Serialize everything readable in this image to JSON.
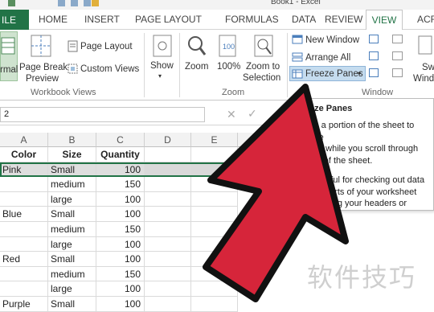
{
  "window": {
    "title": "Book1 - Excel"
  },
  "tabs": {
    "file": "ILE",
    "items": [
      "HOME",
      "INSERT",
      "PAGE LAYOUT",
      "FORMULAS",
      "DATA",
      "REVIEW"
    ],
    "active": "VIEW",
    "clipped": "ACR"
  },
  "ribbon": {
    "normal": "rmal",
    "page_break_preview_1": "Page Break",
    "page_break_preview_2": "Preview",
    "page_layout": "Page Layout",
    "custom_views": "Custom Views",
    "workbook_views_group": "Workbook Views",
    "show": "Show",
    "zoom": "Zoom",
    "zoom_100": "100%",
    "zoom_to_selection_1": "Zoom to",
    "zoom_to_selection_2": "Selection",
    "zoom_group": "Zoom",
    "new_window": "New Window",
    "arrange_all": "Arrange All",
    "freeze_panes": "Freeze Panes",
    "window_group": "Window",
    "switch_windows_1": "Sw",
    "switch_windows_2": "Windo"
  },
  "formula_bar": {
    "name_box": "2",
    "cancel": "✕",
    "enter": "✓"
  },
  "sheet": {
    "columns": [
      "A",
      "B",
      "C",
      "D",
      "E"
    ],
    "header_row": [
      "Color",
      "Size",
      "Quantity"
    ],
    "rows": [
      [
        "Pink",
        "Small",
        "100"
      ],
      [
        "",
        "medium",
        "150"
      ],
      [
        "",
        "large",
        "100"
      ],
      [
        "Blue",
        "Small",
        "100"
      ],
      [
        "",
        "medium",
        "150"
      ],
      [
        "",
        "large",
        "100"
      ],
      [
        "Red",
        "Small",
        "100"
      ],
      [
        "",
        "medium",
        "150"
      ],
      [
        "",
        "large",
        "100"
      ],
      [
        "Purple",
        "Small",
        "100"
      ]
    ]
  },
  "tooltip": {
    "title": "eze Panes",
    "line1": "ze a portion of the sheet to kee",
    "line2": "ible while you scroll through",
    "line3": "est of the sheet.",
    "line4": "s useful for checking out data",
    "line5": "her parts of your worksheet",
    "line6": "ut losing your headers or",
    "line7": "s."
  },
  "watermark": "软件技巧",
  "colors": {
    "excel_green": "#217346",
    "arrow_red": "#d6253a",
    "arrow_outline": "#111111",
    "selection": "#217346"
  }
}
